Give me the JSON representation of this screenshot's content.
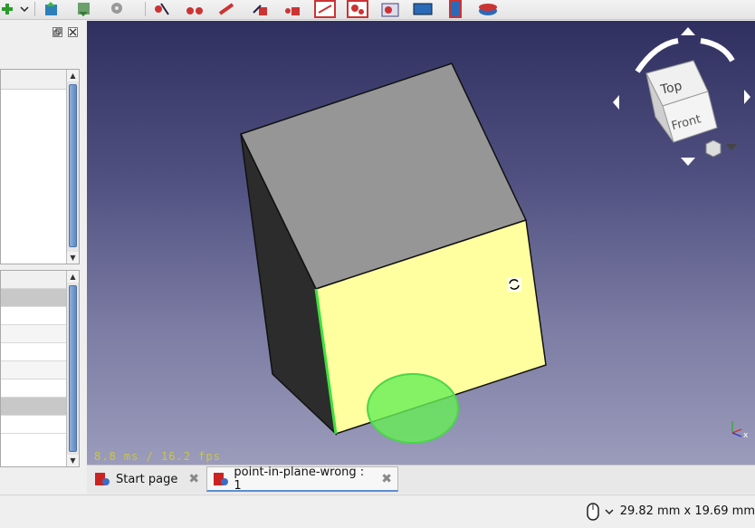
{
  "toolbar": {
    "icons": [
      "add-icon",
      "dropdown-arrow-icon",
      "upload-icon",
      "download-icon",
      "gear-icon",
      "measure-icon",
      "measure-icon-2",
      "wrench-icon",
      "lock-icon",
      "lock-icon-2",
      "constraint-icon",
      "constraint-icon-2",
      "constraint-icon-3",
      "box-icon",
      "cylinder-icon",
      "disk-icon"
    ]
  },
  "view3d": {
    "fps_text": "8.8 ms / 16.2 fps",
    "navcube": {
      "top_label": "Top",
      "front_label": "Front"
    }
  },
  "tabs": [
    {
      "label": "Start page",
      "active": false
    },
    {
      "label": "point-in-plane-wrong : 1",
      "active": true
    }
  ],
  "status": {
    "dimensions": "29.82 mm x 19.69 mm"
  },
  "colors": {
    "accent": "#5b8fd0",
    "face_highlight": "#ffffa0",
    "selection_green": "#50e050"
  }
}
